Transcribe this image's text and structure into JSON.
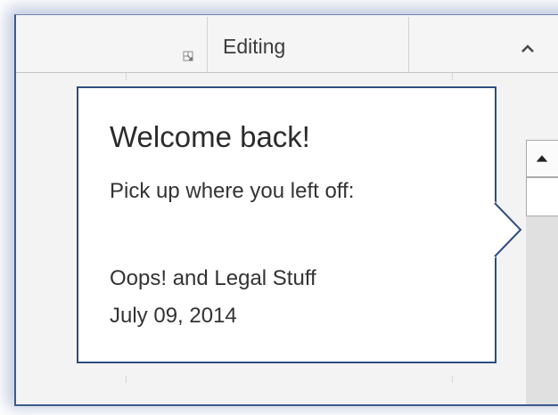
{
  "ribbon": {
    "group_label": "Editing",
    "dialog_launcher_icon": "dialog-launcher-icon",
    "collapse_icon": "chevron-up-icon"
  },
  "scrollbar": {
    "up_icon": "triangle-up-icon"
  },
  "callout": {
    "title": "Welcome back!",
    "subtitle": "Pick up where you left off:",
    "document_name": "Oops! and Legal Stuff",
    "document_date": "July 09, 2014",
    "border_color": "#2f4d80"
  },
  "colors": {
    "window_border": "#3d5a8a",
    "background": "#f3f3f3",
    "ribbon": "#f5f5f5"
  }
}
